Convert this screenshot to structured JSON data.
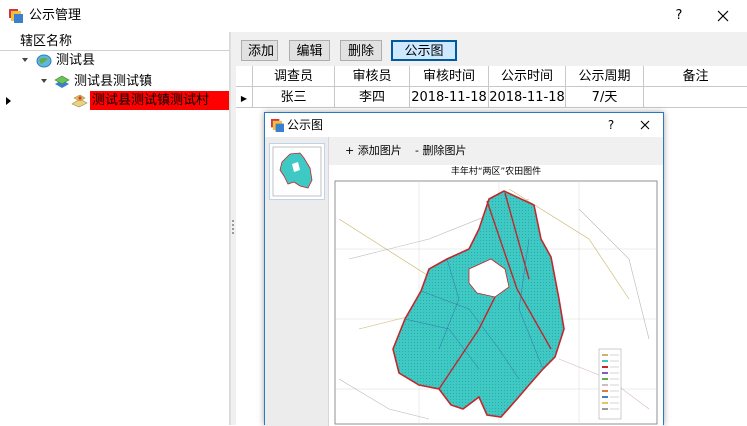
{
  "window": {
    "title": "公示管理",
    "help_glyph": "?"
  },
  "tree": {
    "header": "辖区名称",
    "nodes": [
      {
        "label": "测试县",
        "level": 0
      },
      {
        "label": "测试县测试镇",
        "level": 1
      },
      {
        "label": "测试县测试镇测试村",
        "level": 2,
        "selected": true
      }
    ]
  },
  "toolbar": {
    "add_label": "添加",
    "edit_label": "编辑",
    "delete_label": "删除",
    "notice_map_label": "公示图"
  },
  "grid": {
    "columns": [
      "调查员",
      "审核员",
      "审核时间",
      "公示时间",
      "公示周期",
      "备注"
    ],
    "rows": [
      [
        "张三",
        "李四",
        "2018-11-18",
        "2018-11-18",
        "7/天",
        ""
      ]
    ],
    "row_pointer_glyph": "▶"
  },
  "dialog": {
    "title": "公示图",
    "help_glyph": "?",
    "add_image_label": "+ 添加图片",
    "delete_image_label": "- 删除图片",
    "map_title": "丰年村“两区”农田图件"
  },
  "colors": {
    "selection_bg": "#ff0000",
    "active_button_border": "#005a9e",
    "active_button_bg": "#cde8ff",
    "map_fill": "#3ec9c4",
    "map_outline": "#c0282d"
  }
}
